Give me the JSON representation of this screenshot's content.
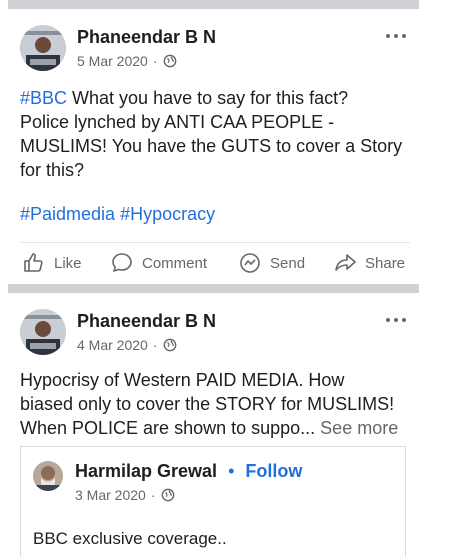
{
  "posts": [
    {
      "author": "Phaneendar B N",
      "date": "5 Mar 2020",
      "text_lines": [
        {
          "tag": "#BBC",
          "rest": " What you have to say for this fact?"
        },
        {
          "tag": "",
          "rest": "Police lynched by ANTI CAA PEOPLE -"
        },
        {
          "tag": "",
          "rest": "MUSLIMS! You have the GUTS to cover a Story"
        },
        {
          "tag": "",
          "rest": "for this?"
        }
      ],
      "hashtags": [
        "#Paidmedia",
        "#Hypocracy"
      ],
      "actions": {
        "like": "Like",
        "comment": "Comment",
        "send": "Send",
        "share": "Share"
      }
    },
    {
      "author": "Phaneendar B N",
      "date": "4 Mar 2020",
      "text_lines": [
        "Hypocrisy of Western PAID MEDIA. How",
        "biased only to cover the STORY for MUSLIMS!",
        "When POLICE  are shown to suppo..."
      ],
      "see_more": "See more",
      "shared": {
        "author": "Harmilap Grewal",
        "separator": "•",
        "follow": "Follow",
        "date": "3 Mar 2020",
        "text": "BBC exclusive coverage.."
      }
    }
  ],
  "colors": {
    "link": "#216fdb",
    "muted": "#65676b",
    "divider": "#cfd1d4"
  },
  "icons": [
    "globe-icon",
    "more-icon",
    "like-icon",
    "comment-icon",
    "send-icon",
    "share-icon"
  ]
}
